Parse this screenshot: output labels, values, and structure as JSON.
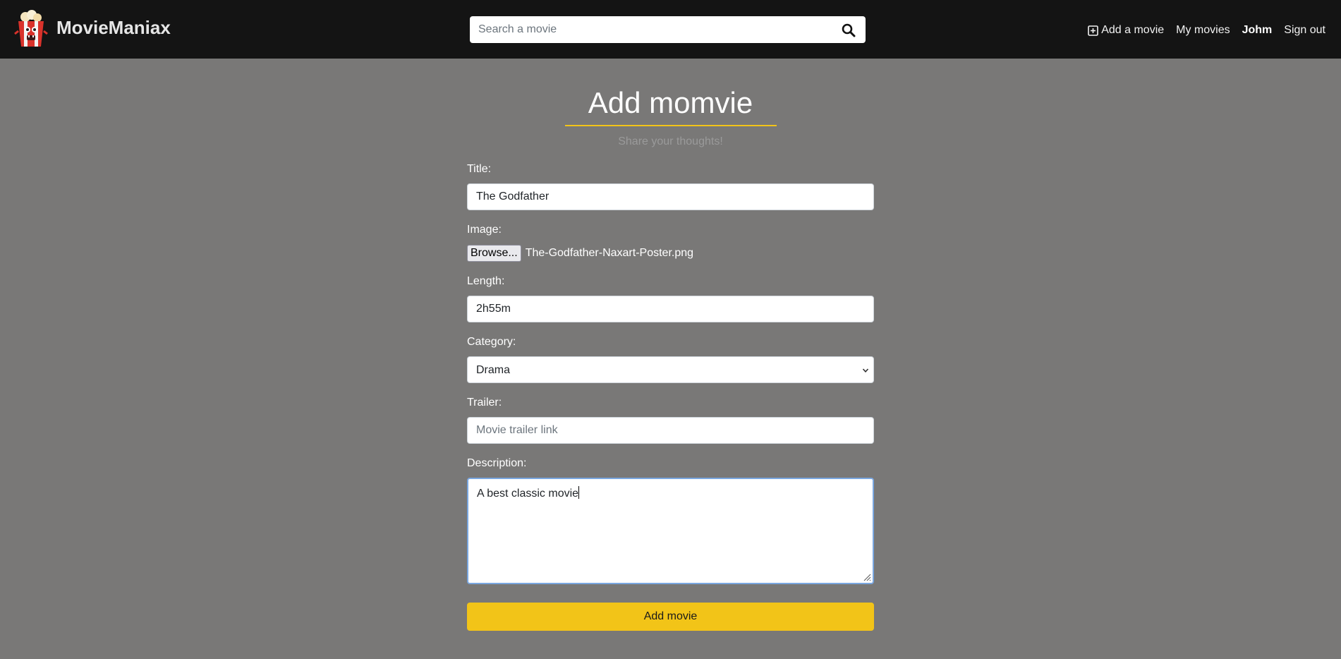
{
  "navbar": {
    "brand_name": "MovieManiax",
    "search_placeholder": "Search a movie",
    "add_movie_label": "Add a movie",
    "my_movies_label": "My movies",
    "username": "Johm",
    "sign_out_label": "Sign out"
  },
  "form": {
    "title": "Add momvie",
    "subtitle": "Share your thoughts!",
    "title_label": "Title:",
    "title_value": "The Godfather",
    "image_label": "Image:",
    "browse_label": "Browse...",
    "image_file_name": "The-Godfather-Naxart-Poster.png",
    "length_label": "Length:",
    "length_value": "2h55m",
    "category_label": "Category:",
    "category_value": "Drama",
    "trailer_label": "Trailer:",
    "trailer_placeholder": "Movie trailer link",
    "description_label": "Description:",
    "description_value": "A best classic movie",
    "submit_label": "Add movie"
  },
  "colors": {
    "navbar_bg": "#141414",
    "page_bg": "#797877",
    "accent": "#f2c418"
  },
  "icons": {
    "logo": "popcorn-mascot-icon",
    "search": "search-icon",
    "add": "plus-square-icon",
    "select": "chevron-down-icon"
  }
}
